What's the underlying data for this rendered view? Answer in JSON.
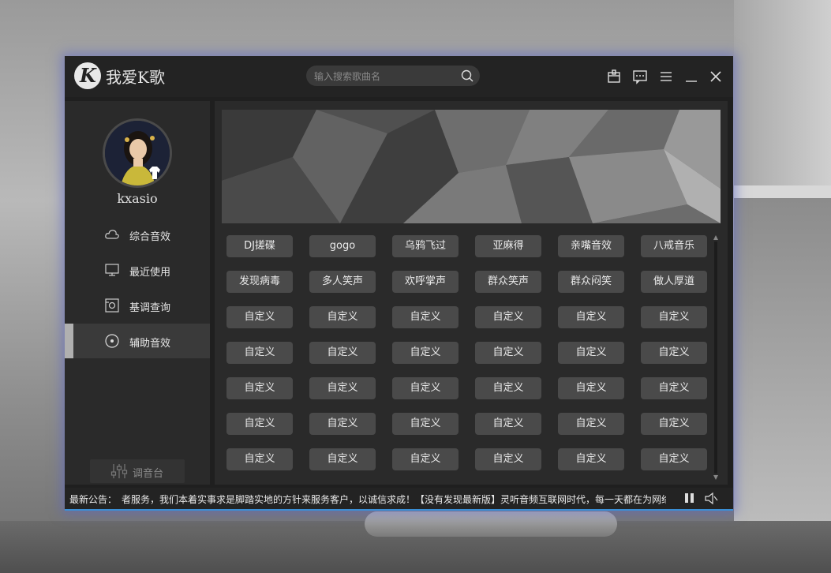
{
  "app": {
    "title": "我爱K歌"
  },
  "search": {
    "placeholder": "输入搜索歌曲名"
  },
  "user": {
    "name": "kxasio"
  },
  "sidebar": {
    "items": [
      {
        "label": "综合音效",
        "icon": "cloud-icon"
      },
      {
        "label": "最近使用",
        "icon": "monitor-icon"
      },
      {
        "label": "基调查询",
        "icon": "image-search-icon"
      },
      {
        "label": "辅助音效",
        "icon": "target-icon",
        "active": true
      }
    ],
    "mixer_label": "调音台"
  },
  "effects": [
    [
      "DJ搓碟",
      "gogo",
      "乌鸦飞过",
      "亚麻得",
      "亲嘴音效",
      "八戒音乐"
    ],
    [
      "发现病毒",
      "多人笑声",
      "欢呼掌声",
      "群众笑声",
      "群众闷笑",
      "做人厚道"
    ],
    [
      "自定义",
      "自定义",
      "自定义",
      "自定义",
      "自定义",
      "自定义"
    ],
    [
      "自定义",
      "自定义",
      "自定义",
      "自定义",
      "自定义",
      "自定义"
    ],
    [
      "自定义",
      "自定义",
      "自定义",
      "自定义",
      "自定义",
      "自定义"
    ],
    [
      "自定义",
      "自定义",
      "自定义",
      "自定义",
      "自定义",
      "自定义"
    ],
    [
      "自定义",
      "自定义",
      "自定义",
      "自定义",
      "自定义",
      "自定义"
    ]
  ],
  "status": {
    "label": "最新公告：",
    "text": "者服务，我们本着实事求是脚踏实地的方针来服务客户，以诚信求成！【没有发现最新版】灵听音频互联网时代，每一天都在为网络"
  },
  "colors": {
    "accent": "#3a8fd6",
    "button": "#4a4a4a",
    "window": "#1f1f1f"
  }
}
